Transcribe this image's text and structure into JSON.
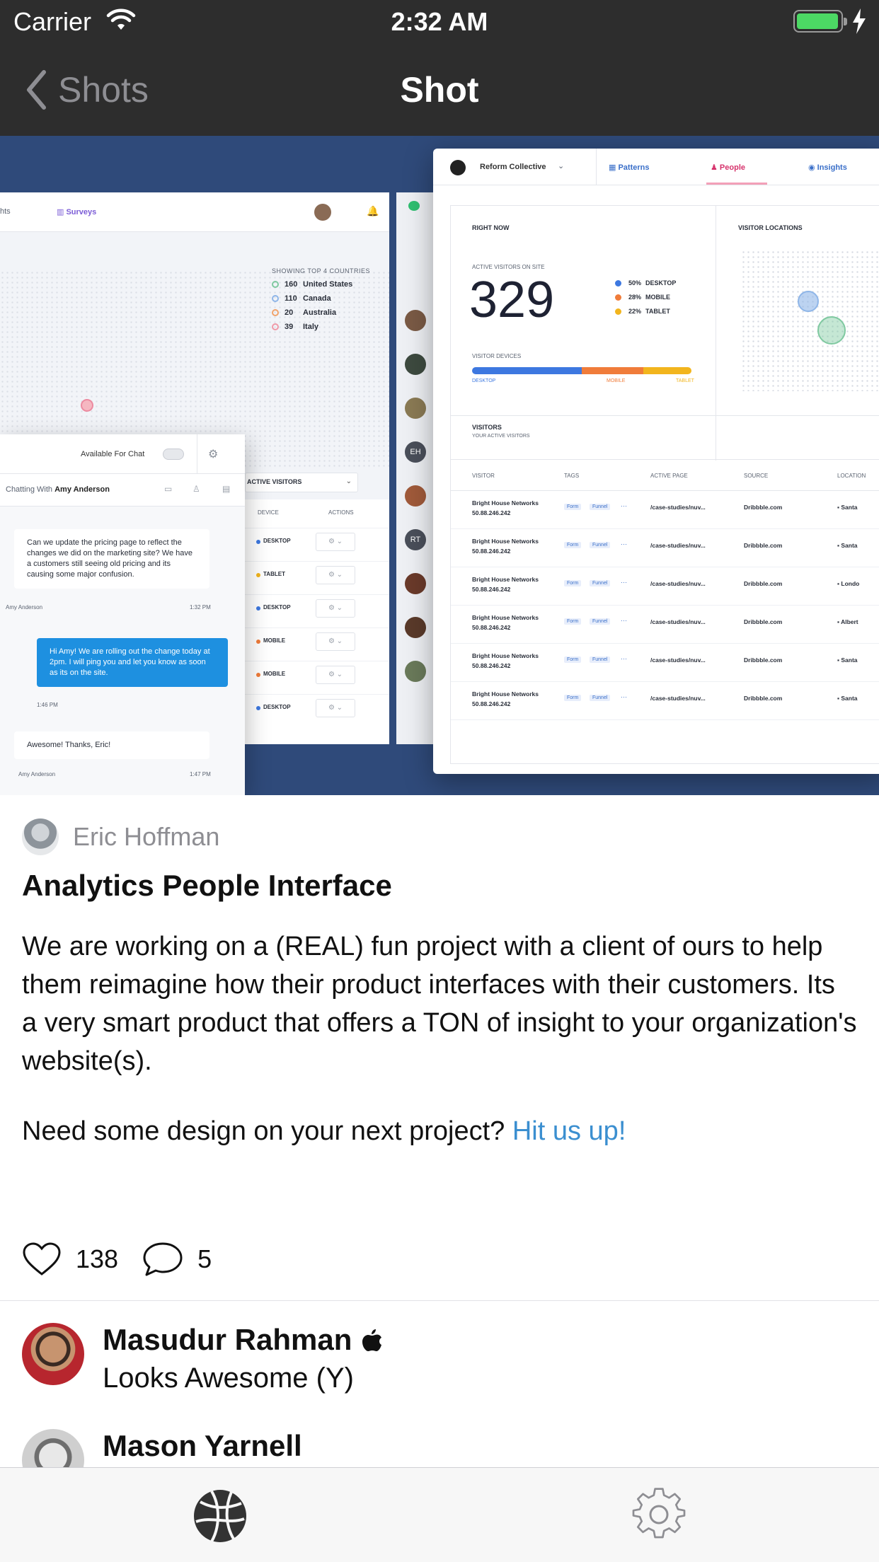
{
  "status_bar": {
    "carrier": "Carrier",
    "time": "2:32 AM"
  },
  "nav": {
    "back_label": "Shots",
    "title": "Shot"
  },
  "shot_image": {
    "back_panel": {
      "tabs": [
        "hts",
        "Surveys"
      ],
      "countries_header": "SHOWING TOP 4 COUNTRIES",
      "countries": [
        {
          "count": "160",
          "name": "United States",
          "color": "#7fc9a0"
        },
        {
          "count": "110",
          "name": "Canada",
          "color": "#8fb6e8"
        },
        {
          "count": "20",
          "name": "Australia",
          "color": "#f0a36b"
        },
        {
          "count": "39",
          "name": "Italy",
          "color": "#f09aa8"
        }
      ],
      "active_visitors_label": "ACTIVE VISITORS",
      "device_header": "DEVICE",
      "actions_header": "ACTIONS",
      "device_rows": [
        "DESKTOP",
        "TABLET",
        "DESKTOP",
        "MOBILE",
        "MOBILE",
        "DESKTOP"
      ]
    },
    "rail_initials": [
      "EH",
      "RT"
    ],
    "chat": {
      "availability": "Available For Chat",
      "chatting_prefix": "Chatting With",
      "chatting_name": "Amy Anderson",
      "msg1": "Can we update the pricing page to reflect the changes we did on the marketing site? We have a customers still seeing old pricing and its causing some major confusion.",
      "msg1_author": "Amy Anderson",
      "msg1_time": "1:32 PM",
      "msg2": "Hi Amy! We are rolling out the change today at 2pm. I will ping you and let you know as soon as its on the site.",
      "msg2_time": "1:46 PM",
      "msg3": "Awesome! Thanks, Eric!",
      "msg3_author": "Amy Anderson",
      "msg3_time": "1:47 PM"
    },
    "front_panel": {
      "org": "Reform Collective",
      "tabs": [
        "Patterns",
        "People",
        "Insights"
      ],
      "right_now": "RIGHT NOW",
      "visitor_locations": "VISITOR LOCATIONS",
      "active_visitors_on_site": "ACTIVE VISITORS ON SITE",
      "big_number": "329",
      "device_split": [
        {
          "pct": "50%",
          "label": "DESKTOP",
          "color": "#3d78e0"
        },
        {
          "pct": "28%",
          "label": "MOBILE",
          "color": "#f07c3a"
        },
        {
          "pct": "22%",
          "label": "TABLET",
          "color": "#f2b51d"
        }
      ],
      "visitor_devices": "VISITOR DEVICES",
      "bar_labels": [
        "DESKTOP",
        "MOBILE",
        "TABLET"
      ],
      "visitors_title": "VISITORS",
      "visitors_sub": "YOUR ACTIVE VISITORS",
      "columns": [
        "VISITOR",
        "TAGS",
        "ACTIVE PAGE",
        "SOURCE",
        "LOCATION"
      ],
      "rows": [
        {
          "name": "Bright House Networks",
          "ip": "50.88.246.242",
          "page": "/case-studies/nuv...",
          "source": "Dribbble.com",
          "loc": "Santa"
        },
        {
          "name": "Bright House Networks",
          "ip": "50.88.246.242",
          "page": "/case-studies/nuv...",
          "source": "Dribbble.com",
          "loc": "Santa"
        },
        {
          "name": "Bright House Networks",
          "ip": "50.88.246.242",
          "page": "/case-studies/nuv...",
          "source": "Dribbble.com",
          "loc": "Londo"
        },
        {
          "name": "Bright House Networks",
          "ip": "50.88.246.242",
          "page": "/case-studies/nuv...",
          "source": "Dribbble.com",
          "loc": "Albert"
        },
        {
          "name": "Bright House Networks",
          "ip": "50.88.246.242",
          "page": "/case-studies/nuv...",
          "source": "Dribbble.com",
          "loc": "Santa"
        },
        {
          "name": "Bright House Networks",
          "ip": "50.88.246.242",
          "page": "/case-studies/nuv...",
          "source": "Dribbble.com",
          "loc": "Santa"
        }
      ],
      "tag_form": "Form",
      "tag_funnel": "Funnel"
    }
  },
  "author": {
    "name": "Eric Hoffman"
  },
  "shot": {
    "title": "Analytics People Interface",
    "description": "We are working on a (REAL) fun project with a client of ours to help them reimagine how their product interfaces with their customers. Its a very smart product that offers a TON of insight to your organization's website(s).",
    "cta_text": "Need some design on your next project?",
    "cta_link": "Hit us up!"
  },
  "stats": {
    "likes": "138",
    "comments": "5"
  },
  "comments": [
    {
      "name": "Masudur Rahman",
      "text": "Looks Awesome (Y)"
    },
    {
      "name": "Mason Yarnell",
      "text": ""
    }
  ],
  "tabbar": {
    "items": [
      "shots-tab",
      "settings-tab"
    ]
  }
}
